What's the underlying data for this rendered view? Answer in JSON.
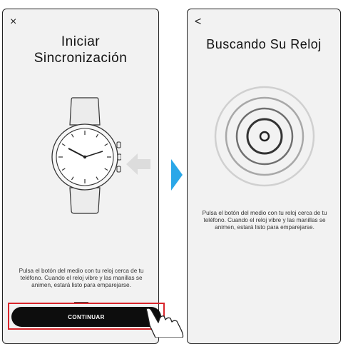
{
  "pair_screen": {
    "close_icon": "×",
    "title_line1": "Iniciar",
    "title_line2": "Sincronización",
    "instruction": "Pulsa el botón del medio con tu reloj cerca de tu teléfono. Cuando el reloj vibre y las manillas se animen, estará listo para emparejarse.",
    "continue_label": "CONTINUAR"
  },
  "search_screen": {
    "back_icon": "<",
    "title": "Buscando Su Reloj",
    "instruction": "Pulsa el botón del medio con tu reloj cerca de tu teléfono. Cuando el reloj vibre y las manillas se animen, estará listo para emparejarse."
  },
  "colors": {
    "highlight": "#d9252b",
    "connector_arrow": "#2aa7e8",
    "button": "#0d0d0d",
    "screen_bg": "#f2f2f2"
  }
}
